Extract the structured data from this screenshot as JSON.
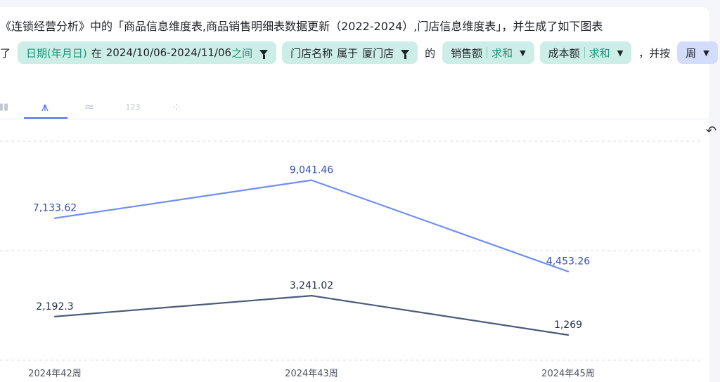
{
  "question": {
    "line1": "《连锁经营分析》中的「商品信息维度表,商品销售明细表数据更新（2022-2024）,门店信息维度表」，并生成了如下图表",
    "line2_prefix": "了",
    "date_filter": {
      "field": "日期(年月日)",
      "op": "在",
      "value": "2024/10/06-2024/11/06",
      "suffix": "之间"
    },
    "store_filter": {
      "field": "门店名称",
      "op": "属于",
      "value": "厦门店"
    },
    "de": "的",
    "metric1": {
      "name": "销售额",
      "agg": "求和"
    },
    "metric2": {
      "name": "成本额",
      "agg": "求和"
    },
    "by_text": "，并按",
    "granularity": "周"
  },
  "chart_tabs": [
    {
      "icon": "bar-chart-icon",
      "label": "▮▮"
    },
    {
      "icon": "line-chart-icon",
      "label": "⩚"
    },
    {
      "icon": "area-chart-icon",
      "label": "≈"
    },
    {
      "icon": "number-chart-icon",
      "label": "123"
    },
    {
      "icon": "scatter-chart-icon",
      "label": "⁘"
    }
  ],
  "undo_icon": "↶",
  "colors": {
    "sales": "#6f8ff0",
    "cost": "#4a5a78",
    "label_blue": "#2f4fb6",
    "label_dark": "#1f2a44"
  },
  "chart_data": {
    "type": "line",
    "categories": [
      "2024年42周",
      "2024年43周",
      "2024年45周"
    ],
    "series": [
      {
        "name": "销售额",
        "values": [
          7133.62,
          9041.46,
          4453.26
        ],
        "labels": [
          "7,133.62",
          "9,041.46",
          "4,453.26"
        ]
      },
      {
        "name": "成本额",
        "values": [
          2192.3,
          3241.02,
          1269
        ],
        "labels": [
          "2,192.3",
          "3,241.02",
          "1,269"
        ]
      }
    ],
    "ylim": [
      0,
      11000
    ],
    "grid": true
  }
}
